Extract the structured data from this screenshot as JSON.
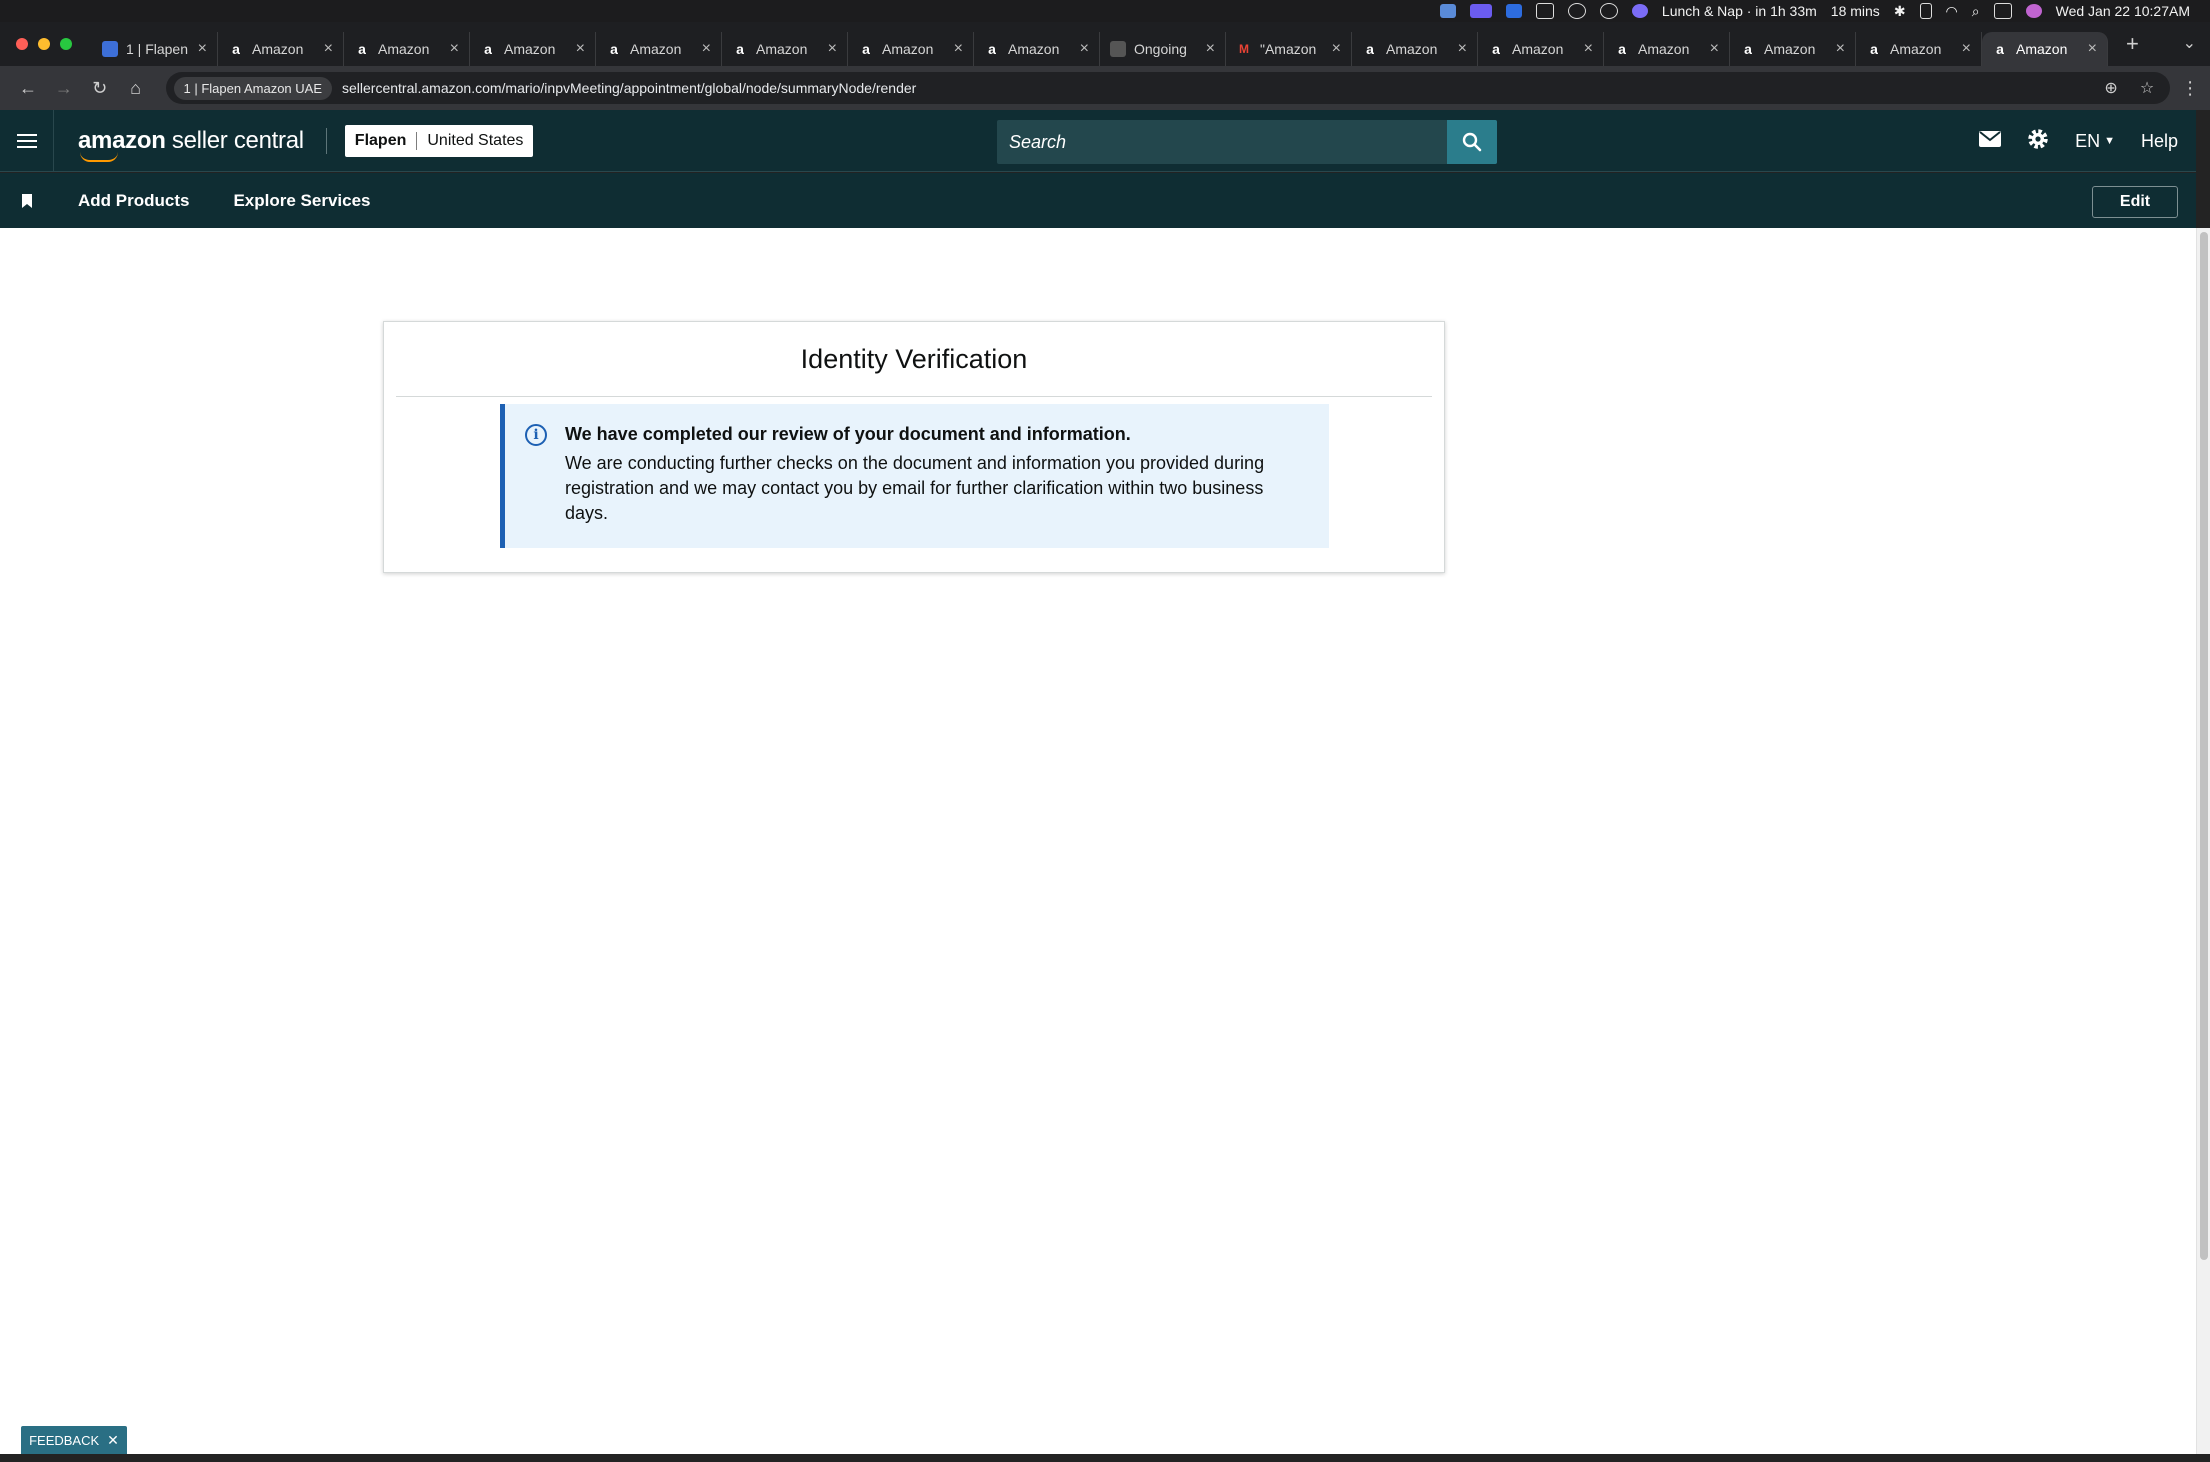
{
  "system": {
    "calendar_event": "Lunch & Nap · in 1h 33m",
    "timer": "18 mins",
    "datetime": "Wed Jan 22  10:27AM"
  },
  "browser": {
    "tabs": [
      {
        "title": "1 | Flapen",
        "icon": "flapen-favicon-icon",
        "active": false
      },
      {
        "title": "Amazon",
        "icon": "amazon-a-icon",
        "active": false
      },
      {
        "title": "Amazon",
        "icon": "amazon-a-icon",
        "active": false
      },
      {
        "title": "Amazon",
        "icon": "amazon-a-icon",
        "active": false
      },
      {
        "title": "Amazon",
        "icon": "amazon-a-icon",
        "active": false
      },
      {
        "title": "Amazon",
        "icon": "amazon-a-icon",
        "active": false
      },
      {
        "title": "Amazon",
        "icon": "amazon-a-icon",
        "active": false
      },
      {
        "title": "Amazon",
        "icon": "amazon-a-icon",
        "active": false
      },
      {
        "title": "Ongoing",
        "icon": "ongoing-favicon-icon",
        "active": false
      },
      {
        "title": "\"Amazon",
        "icon": "gmail-icon",
        "active": false
      },
      {
        "title": "Amazon",
        "icon": "amazon-a-icon",
        "active": false
      },
      {
        "title": "Amazon",
        "icon": "amazon-a-icon",
        "active": false
      },
      {
        "title": "Amazon",
        "icon": "amazon-a-icon",
        "active": false
      },
      {
        "title": "Amazon",
        "icon": "amazon-a-icon",
        "active": false
      },
      {
        "title": "Amazon",
        "icon": "amazon-a-icon",
        "active": false
      },
      {
        "title": "Amazon",
        "icon": "amazon-a-icon",
        "active": true
      }
    ],
    "site_chip": "1 | Flapen Amazon UAE",
    "url": "sellercentral.amazon.com/mario/inpvMeeting/appointment/global/node/summaryNode/render"
  },
  "header": {
    "logo_bold": "amazon",
    "logo_light": " seller central",
    "merchant_name": "Flapen",
    "marketplace": "United States",
    "search_placeholder": "Search",
    "language": "EN",
    "help": "Help"
  },
  "subnav": {
    "items": [
      "Add Products",
      "Explore Services"
    ],
    "edit": "Edit"
  },
  "main": {
    "title": "Identity Verification",
    "alert_heading": "We have completed our review of your document and information.",
    "alert_body": "We are conducting further checks on the document and information you provided during registration and we may contact you by email for further clarification within two business days."
  },
  "feedback": {
    "label": "FEEDBACK"
  },
  "colors": {
    "header_bg": "#0f2d33",
    "search_button": "#2b7d8c",
    "alert_bg": "#e8f3fc",
    "alert_border": "#1d60b3",
    "logo_smile": "#ff9900"
  }
}
